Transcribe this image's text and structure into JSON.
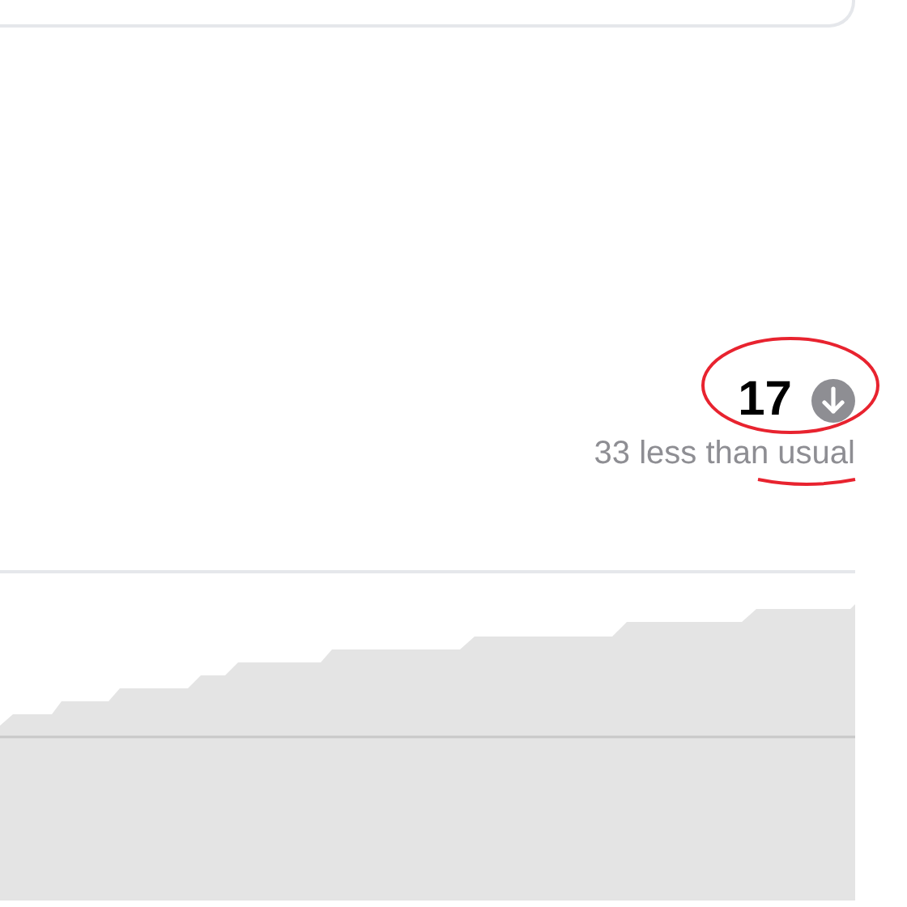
{
  "summary": {
    "count": "17",
    "decreased": true,
    "comparison": "33 less than usual"
  }
}
